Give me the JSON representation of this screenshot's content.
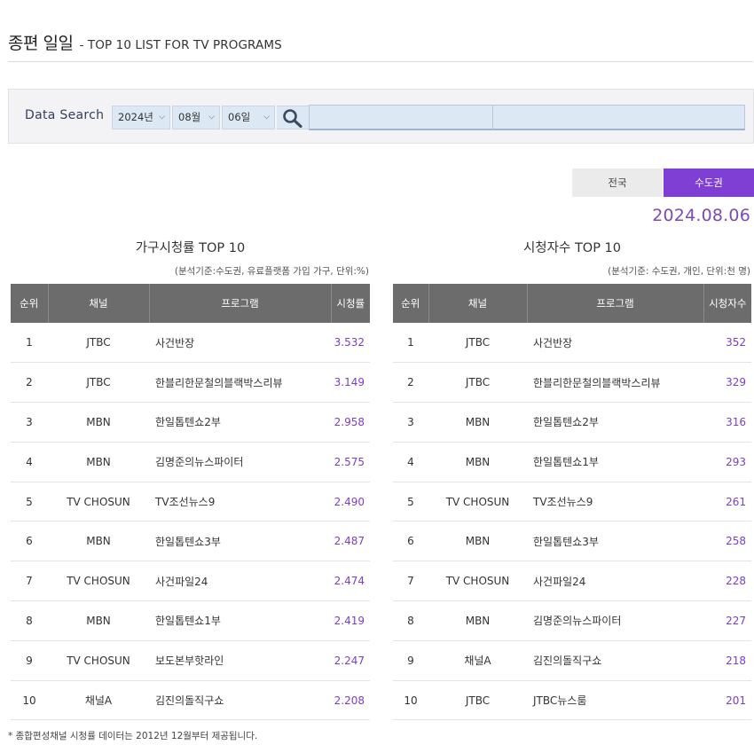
{
  "header": {
    "title_ko": "종편 일일",
    "title_en": "- TOP 10 LIST FOR TV PROGRAMS"
  },
  "search": {
    "label": "Data Search",
    "year": "2024년",
    "month": "08월",
    "day": "06일",
    "icon": "search-icon"
  },
  "region_tabs": {
    "national": "전국",
    "capital": "수도권",
    "selected": "수도권"
  },
  "date": "2024.08.06",
  "household_table": {
    "title": "가구시청률 TOP 10",
    "note": "(분석기준:수도권, 유료플랫폼 가입 가구, 단위:%)",
    "columns": [
      "순위",
      "채널",
      "프로그램",
      "시청률"
    ],
    "rows": [
      {
        "rank": "1",
        "channel": "JTBC",
        "program": "사건반장",
        "value": "3.532"
      },
      {
        "rank": "2",
        "channel": "JTBC",
        "program": "한블리한문철의블랙박스리뷰",
        "value": "3.149"
      },
      {
        "rank": "3",
        "channel": "MBN",
        "program": "한일톱텐쇼2부",
        "value": "2.958"
      },
      {
        "rank": "4",
        "channel": "MBN",
        "program": "김명준의뉴스파이터",
        "value": "2.575"
      },
      {
        "rank": "5",
        "channel": "TV CHOSUN",
        "program": "TV조선뉴스9",
        "value": "2.490"
      },
      {
        "rank": "6",
        "channel": "MBN",
        "program": "한일톱텐쇼3부",
        "value": "2.487"
      },
      {
        "rank": "7",
        "channel": "TV CHOSUN",
        "program": "사건파일24",
        "value": "2.474"
      },
      {
        "rank": "8",
        "channel": "MBN",
        "program": "한일톱텐쇼1부",
        "value": "2.419"
      },
      {
        "rank": "9",
        "channel": "TV CHOSUN",
        "program": "보도본부핫라인",
        "value": "2.247"
      },
      {
        "rank": "10",
        "channel": "채널A",
        "program": "김진의돌직구쇼",
        "value": "2.208"
      }
    ]
  },
  "viewers_table": {
    "title": "시청자수 TOP 10",
    "note": "(분석기준: 수도권, 개인, 단위:천 명)",
    "columns": [
      "순위",
      "채널",
      "프로그램",
      "시청자수"
    ],
    "rows": [
      {
        "rank": "1",
        "channel": "JTBC",
        "program": "사건반장",
        "value": "352"
      },
      {
        "rank": "2",
        "channel": "JTBC",
        "program": "한블리한문철의블랙박스리뷰",
        "value": "329"
      },
      {
        "rank": "3",
        "channel": "MBN",
        "program": "한일톱텐쇼2부",
        "value": "316"
      },
      {
        "rank": "4",
        "channel": "MBN",
        "program": "한일톱텐쇼1부",
        "value": "293"
      },
      {
        "rank": "5",
        "channel": "TV CHOSUN",
        "program": "TV조선뉴스9",
        "value": "261"
      },
      {
        "rank": "6",
        "channel": "MBN",
        "program": "한일톱텐쇼3부",
        "value": "258"
      },
      {
        "rank": "7",
        "channel": "TV CHOSUN",
        "program": "사건파일24",
        "value": "228"
      },
      {
        "rank": "8",
        "channel": "MBN",
        "program": "김명준의뉴스파이터",
        "value": "227"
      },
      {
        "rank": "9",
        "channel": "채널A",
        "program": "김진의돌직구쇼",
        "value": "218"
      },
      {
        "rank": "10",
        "channel": "JTBC",
        "program": "JTBC뉴스룸",
        "value": "201"
      }
    ]
  },
  "footnote": "* 종합편성채널 시청률 데이터는 2012년 12월부터 제공됩니다.",
  "colors": {
    "accent_purple": "#7f3fd4",
    "value_purple": "#7b3fc4",
    "header_gray": "#6c6c6c",
    "search_blue": "#dde8f5"
  }
}
